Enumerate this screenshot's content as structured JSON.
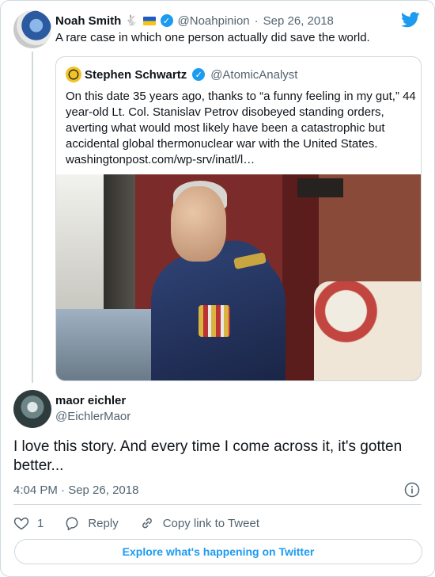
{
  "parent_tweet": {
    "author_name": "Noah Smith",
    "author_emoji": "🐇",
    "author_handle": "@Noahpinion",
    "separator": "·",
    "date": "Sep 26, 2018",
    "text": "A rare case in which one person actually did save the world."
  },
  "quoted_tweet": {
    "author_name": "Stephen Schwartz",
    "author_handle": "@AtomicAnalyst",
    "text": "On this date 35 years ago, thanks to “a funny feeling in my gut,” 44 year-old Lt. Col. Stanislav Petrov disobeyed standing orders, averting what would most likely have been a catastrophic but accidental global thermonuclear war with the United States.",
    "link": "washingtonpost.com/wp-srv/inatl/l…"
  },
  "reply_tweet": {
    "author_name": "maor eichler",
    "author_handle": "@EichlerMaor",
    "text": "I love this story. And every time I come across it, it's gotten better...",
    "timestamp": "4:04 PM · Sep 26, 2018"
  },
  "actions": {
    "like_count": "1",
    "reply_label": "Reply",
    "copy_link_label": "Copy link to Tweet"
  },
  "footer": {
    "explore_label": "Explore what's happening on Twitter"
  },
  "icons": {
    "brand": "twitter-bird-icon",
    "verified": "verified-badge-icon",
    "info": "info-icon",
    "like": "heart-icon",
    "reply": "speech-bubble-icon",
    "copy_link": "link-icon"
  },
  "colors": {
    "accent": "#1d9bf0",
    "text_primary": "#0f1419",
    "text_secondary": "#536471",
    "border": "#cfd9de"
  }
}
